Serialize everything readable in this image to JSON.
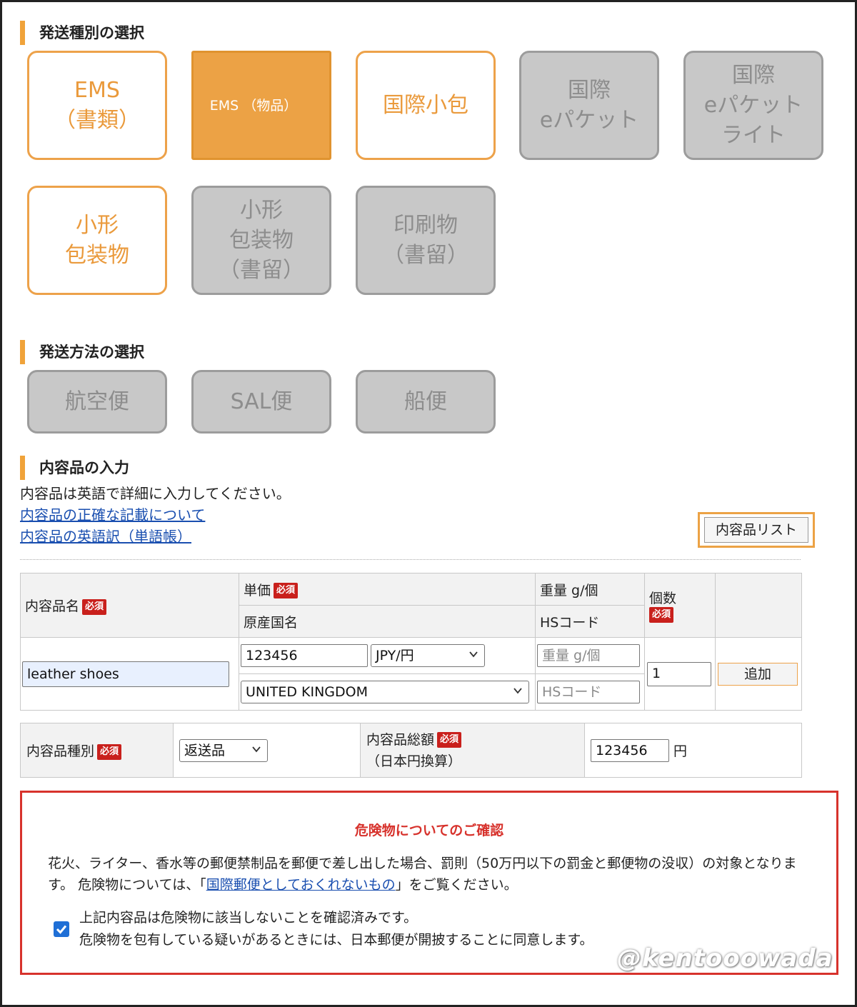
{
  "shipping_type": {
    "title": "発送種別の選択",
    "options": [
      {
        "label": "EMS\n（書類）",
        "state": "available"
      },
      {
        "label": "EMS\n（物品）",
        "state": "selected"
      },
      {
        "label": "国際小包",
        "state": "available"
      },
      {
        "label": "国際\neパケット",
        "state": "disabled"
      },
      {
        "label": "国際\neパケット\nライト",
        "state": "disabled"
      },
      {
        "label": "小形\n包装物",
        "state": "available"
      },
      {
        "label": "小形\n包装物\n（書留）",
        "state": "disabled"
      },
      {
        "label": "印刷物\n（書留）",
        "state": "disabled"
      }
    ]
  },
  "shipping_method": {
    "title": "発送方法の選択",
    "options": [
      {
        "label": "航空便",
        "state": "disabled"
      },
      {
        "label": "SAL便",
        "state": "disabled"
      },
      {
        "label": "船便",
        "state": "disabled"
      }
    ]
  },
  "contents": {
    "title": "内容品の入力",
    "instruction": "内容品は英語で詳細に入力してください。",
    "link_accuracy": "内容品の正確な記載について",
    "link_dictionary": "内容品の英語訳（単語帳）",
    "list_button": "内容品リスト",
    "required_badge": "必須",
    "headers": {
      "name": "内容品名",
      "unit_price": "単価",
      "origin": "原産国名",
      "weight": "重量 g/個",
      "hs_code": "HSコード",
      "quantity": "個数"
    },
    "row": {
      "name_value": "leather shoes",
      "price_value": "123456",
      "currency": "JPY/円",
      "origin_value": "UNITED KINGDOM",
      "weight_placeholder": "重量 g/個",
      "hs_placeholder": "HSコード",
      "quantity_value": "1",
      "add_button": "追加"
    },
    "category_label": "内容品種別",
    "category_value": "返送品",
    "total_label": "内容品総額",
    "total_note": "（日本円換算）",
    "total_value": "123456",
    "total_unit": "円"
  },
  "warning": {
    "title": "危険物についてのご確認",
    "text_1": "花火、ライター、香水等の郵便禁制品を郵便で差し出した場合、罰則（50万円以下の罰金と郵便物の没収）の対象となります。 危険物については、「",
    "link": "国際郵便としておくれないもの",
    "text_2": "」をご覧ください。",
    "check_line_1": "上記内容品は危険物に該当しないことを確認済みです。",
    "check_line_2": "危険物を包有している疑いがあるときには、日本郵便が開披することに同意します。",
    "checked": true
  },
  "watermark": "@kentooowada",
  "colors": {
    "accent": "#eca245",
    "disabled": "#c8c8c8",
    "required": "#c9201c",
    "link": "#1a4fb0",
    "warning": "#d7322c",
    "checkbox": "#1f6fd6"
  }
}
